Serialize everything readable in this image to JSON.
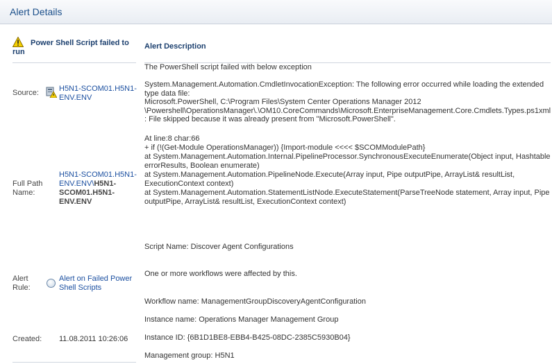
{
  "header": {
    "title": "Alert Details"
  },
  "left": {
    "alert_title": "Power Shell Script failed to run",
    "source_label": "Source:",
    "source_value": "H5N1-SCOM01.H5N1-ENV.ENV",
    "fullpath_label": "Full Path Name:",
    "fullpath_link": "H5N1-SCOM01.H5N1-ENV.ENV\\",
    "fullpath_bold": "H5N1-SCOM01.H5N1-ENV.ENV",
    "rule_label": "Alert Rule:",
    "rule_value": "Alert on Failed Power Shell Scripts",
    "created_label": "Created:",
    "created_value": "11.08.2011 10:26:06"
  },
  "right": {
    "heading": "Alert Description",
    "p1": "The PowerShell script failed with below exception",
    "p2": "System.Management.Automation.CmdletInvocationException: The following error occurred while loading the extended type data file:",
    "p3": "Microsoft.PowerShell, C:\\Program Files\\System Center Operations Manager 2012 \\Powershell\\OperationsManager\\.\\OM10.CoreCommands\\Microsoft.EnterpriseManagement.Core.Cmdlets.Types.ps1xml : File skipped because it was already present from \"Microsoft.PowerShell\".",
    "p4": "At line:8 char:66",
    "p5": "+ if (!(Get-Module OperationsManager)) {Import-module <<<< $SCOMModulePath}",
    "p6": "at System.Management.Automation.Internal.PipelineProcessor.SynchronousExecuteEnumerate(Object input, Hashtable errorResults, Boolean enumerate)",
    "p7": "at System.Management.Automation.PipelineNode.Execute(Array input, Pipe outputPipe, ArrayList& resultList, ExecutionContext context)",
    "p8": "at System.Management.Automation.StatementListNode.ExecuteStatement(ParseTreeNode statement, Array input, Pipe outputPipe, ArrayList& resultList, ExecutionContext context)",
    "p9": "Script Name: Discover Agent Configurations",
    "p10": "One or more workflows were affected by this.",
    "p11": "Workflow name: ManagementGroupDiscoveryAgentConfiguration",
    "p12": "Instance name: Operations Manager Management Group",
    "p13": "Instance ID: {6B1D1BE8-EBB4-B425-08DC-2385C5930B04}",
    "p14": "Management group: H5N1"
  }
}
